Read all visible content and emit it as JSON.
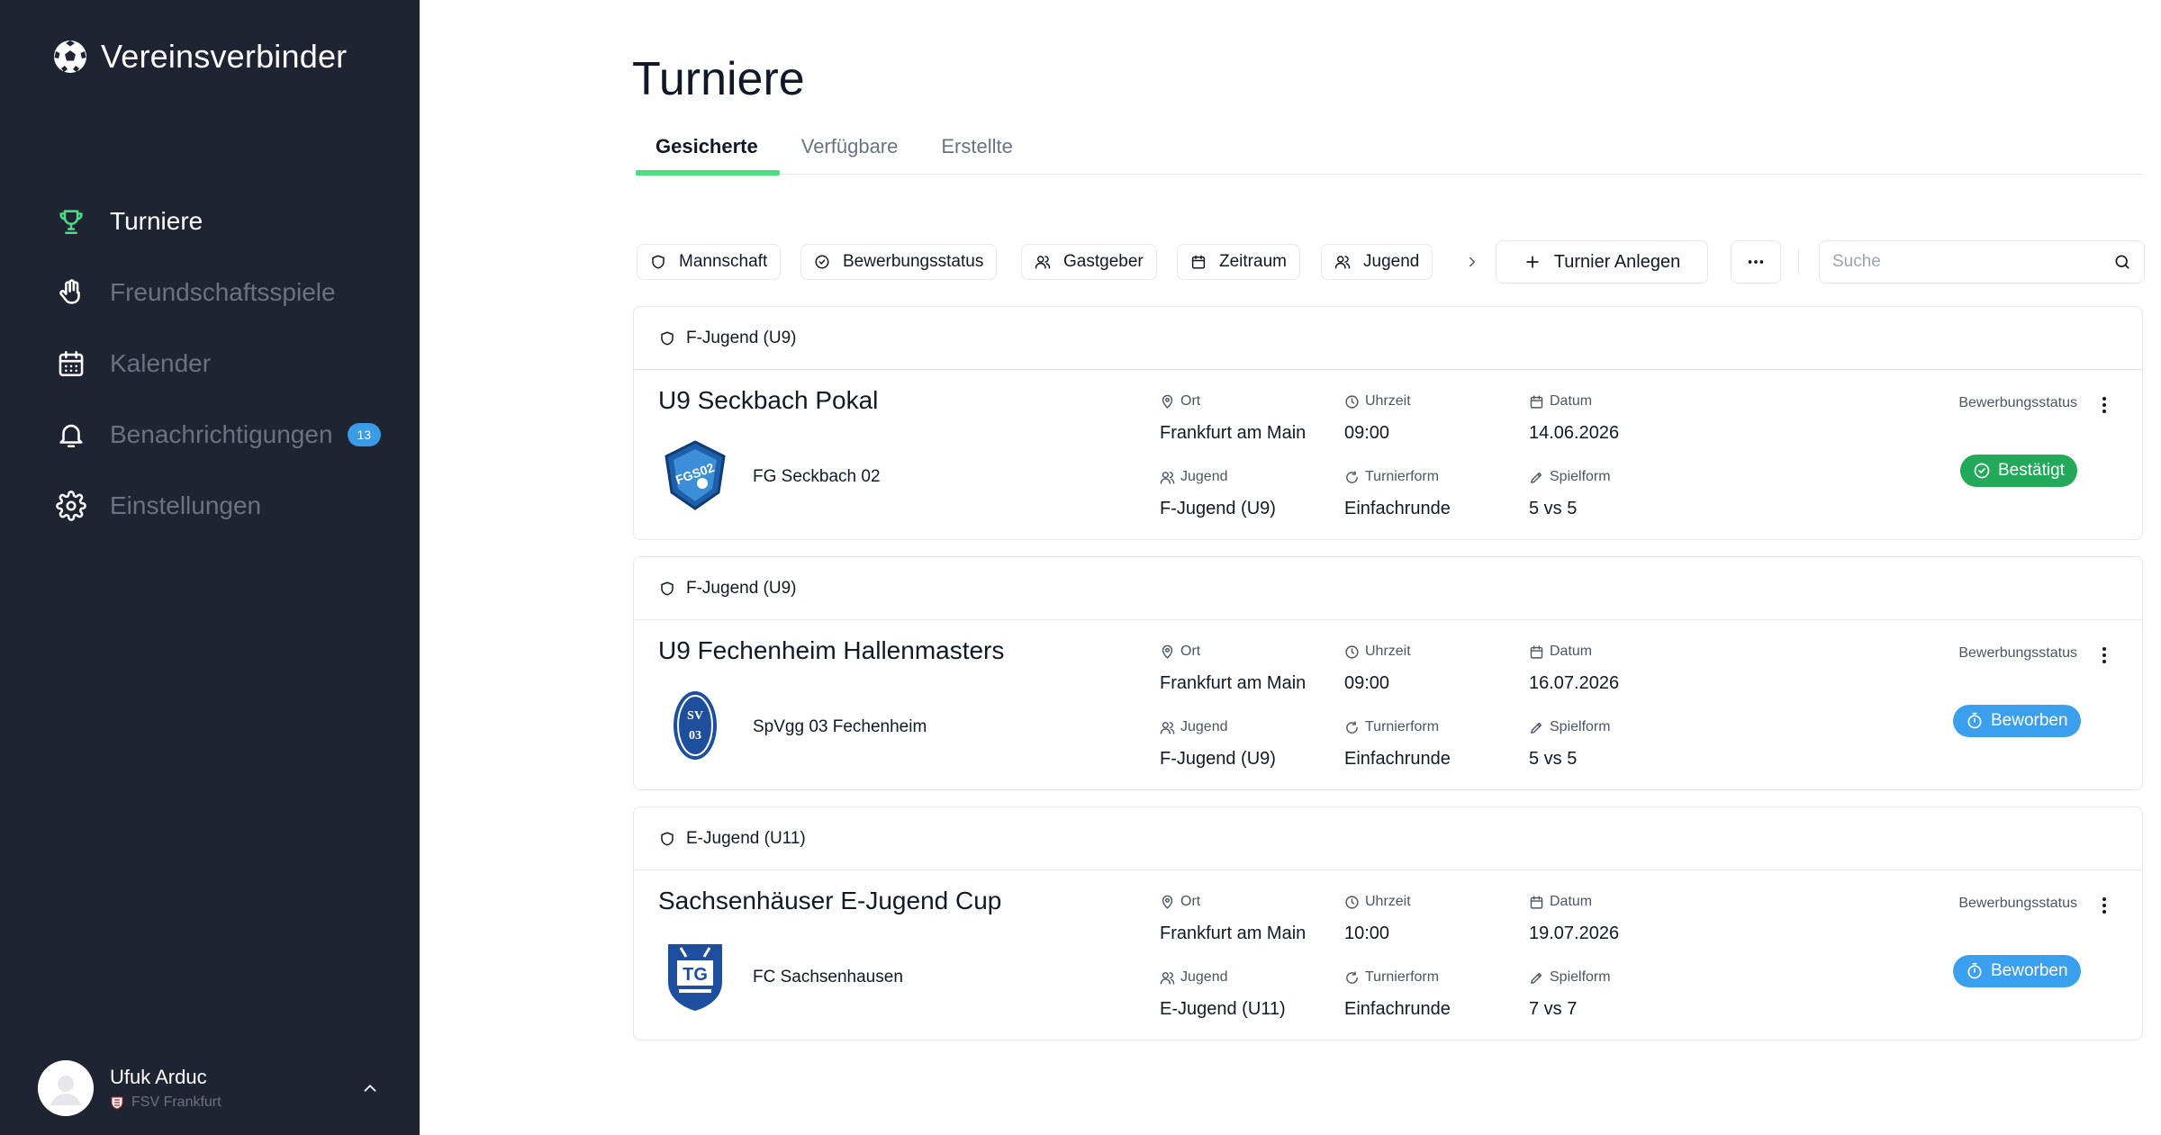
{
  "app": {
    "name": "Vereinsverbinder"
  },
  "sidebar": {
    "items": [
      {
        "label": "Turniere",
        "icon": "trophy-icon",
        "active": true
      },
      {
        "label": "Freundschaftsspiele",
        "icon": "handshake-icon",
        "active": false
      },
      {
        "label": "Kalender",
        "icon": "calendar-icon",
        "active": false
      },
      {
        "label": "Benachrichtigungen",
        "icon": "bell-icon",
        "active": false,
        "badge": "13"
      },
      {
        "label": "Einstellungen",
        "icon": "gear-icon",
        "active": false
      }
    ],
    "user": {
      "name": "Ufuk Arduc",
      "club": "FSV Frankfurt"
    }
  },
  "page": {
    "title": "Turniere"
  },
  "tabs": [
    {
      "label": "Gesicherte",
      "active": true
    },
    {
      "label": "Verfügbare",
      "active": false
    },
    {
      "label": "Erstellte",
      "active": false
    }
  ],
  "filters": {
    "mannschaft": "Mannschaft",
    "bewerbungsstatus": "Bewerbungsstatus",
    "gastgeber": "Gastgeber",
    "zeitraum": "Zeitraum",
    "jugend": "Jugend"
  },
  "toolbar": {
    "new_label": "Turnier Anlegen",
    "search_placeholder": "Suche"
  },
  "labels": {
    "ort": "Ort",
    "uhrzeit": "Uhrzeit",
    "datum": "Datum",
    "jugend": "Jugend",
    "turnierform": "Turnierform",
    "spielform": "Spielform",
    "bewerbungsstatus": "Bewerbungsstatus"
  },
  "colors": {
    "sidebar_bg": "#1f2433",
    "accent_green": "#4ade80",
    "status_confirmed": "#22a95a",
    "status_applied": "#3aa0ee"
  },
  "tournaments": [
    {
      "group": "F-Jugend (U9)",
      "title": "U9 Seckbach Pokal",
      "club": "FG Seckbach 02",
      "ort": "Frankfurt am Main",
      "uhrzeit": "09:00",
      "datum": "14.06.2026",
      "jugend": "F-Jugend (U9)",
      "turnierform": "Einfachrunde",
      "spielform": "5 vs 5",
      "status": "Bestätigt",
      "status_type": "confirmed"
    },
    {
      "group": "F-Jugend (U9)",
      "title": "U9 Fechenheim Hallenmasters",
      "club": "SpVgg 03 Fechenheim",
      "ort": "Frankfurt am Main",
      "uhrzeit": "09:00",
      "datum": "16.07.2026",
      "jugend": "F-Jugend (U9)",
      "turnierform": "Einfachrunde",
      "spielform": "5 vs 5",
      "status": "Beworben",
      "status_type": "applied"
    },
    {
      "group": "E-Jugend (U11)",
      "title": "Sachsenhäuser E-Jugend Cup",
      "club": "FC Sachsenhausen",
      "ort": "Frankfurt am Main",
      "uhrzeit": "10:00",
      "datum": "19.07.2026",
      "jugend": "E-Jugend (U11)",
      "turnierform": "Einfachrunde",
      "spielform": "7 vs 7",
      "status": "Beworben",
      "status_type": "applied"
    }
  ]
}
